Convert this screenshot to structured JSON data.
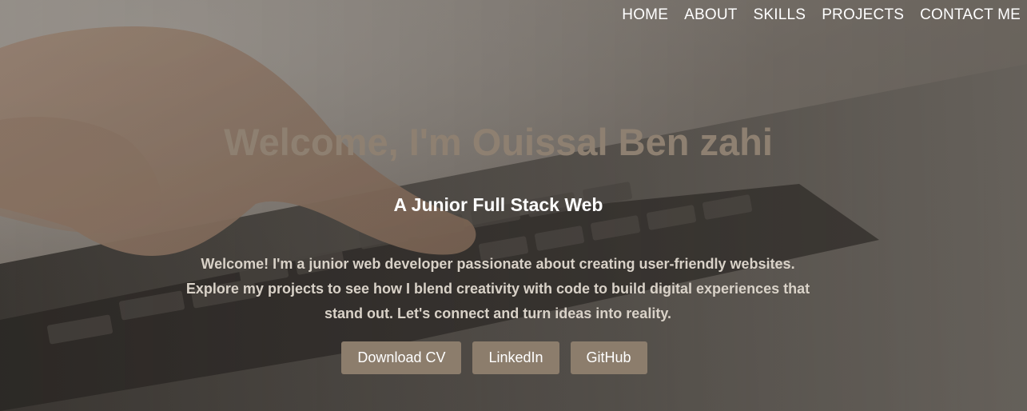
{
  "nav": {
    "items": [
      {
        "label": "HOME"
      },
      {
        "label": "ABOUT"
      },
      {
        "label": "SKILLS"
      },
      {
        "label": "PROJECTS"
      },
      {
        "label": "CONTACT ME"
      }
    ]
  },
  "hero": {
    "title": "Welcome, I'm Ouissal Ben zahi",
    "subtitle": "A Junior Full Stack Web",
    "intro": "Welcome! I'm a junior web developer passionate about creating user-friendly websites. Explore my projects to see how I blend creativity with code to build digital experiences that stand out. Let's connect and turn ideas into reality.",
    "buttons": [
      {
        "label": "Download CV"
      },
      {
        "label": "LinkedIn"
      },
      {
        "label": "GitHub"
      }
    ]
  },
  "colors": {
    "title": "#8e8071",
    "button_bg": "#8c7d6c",
    "intro_text": "#d9d2c8",
    "nav_text": "#ffffff"
  },
  "background": {
    "icon": "hand-typing-on-laptop-keyboard-photo"
  }
}
